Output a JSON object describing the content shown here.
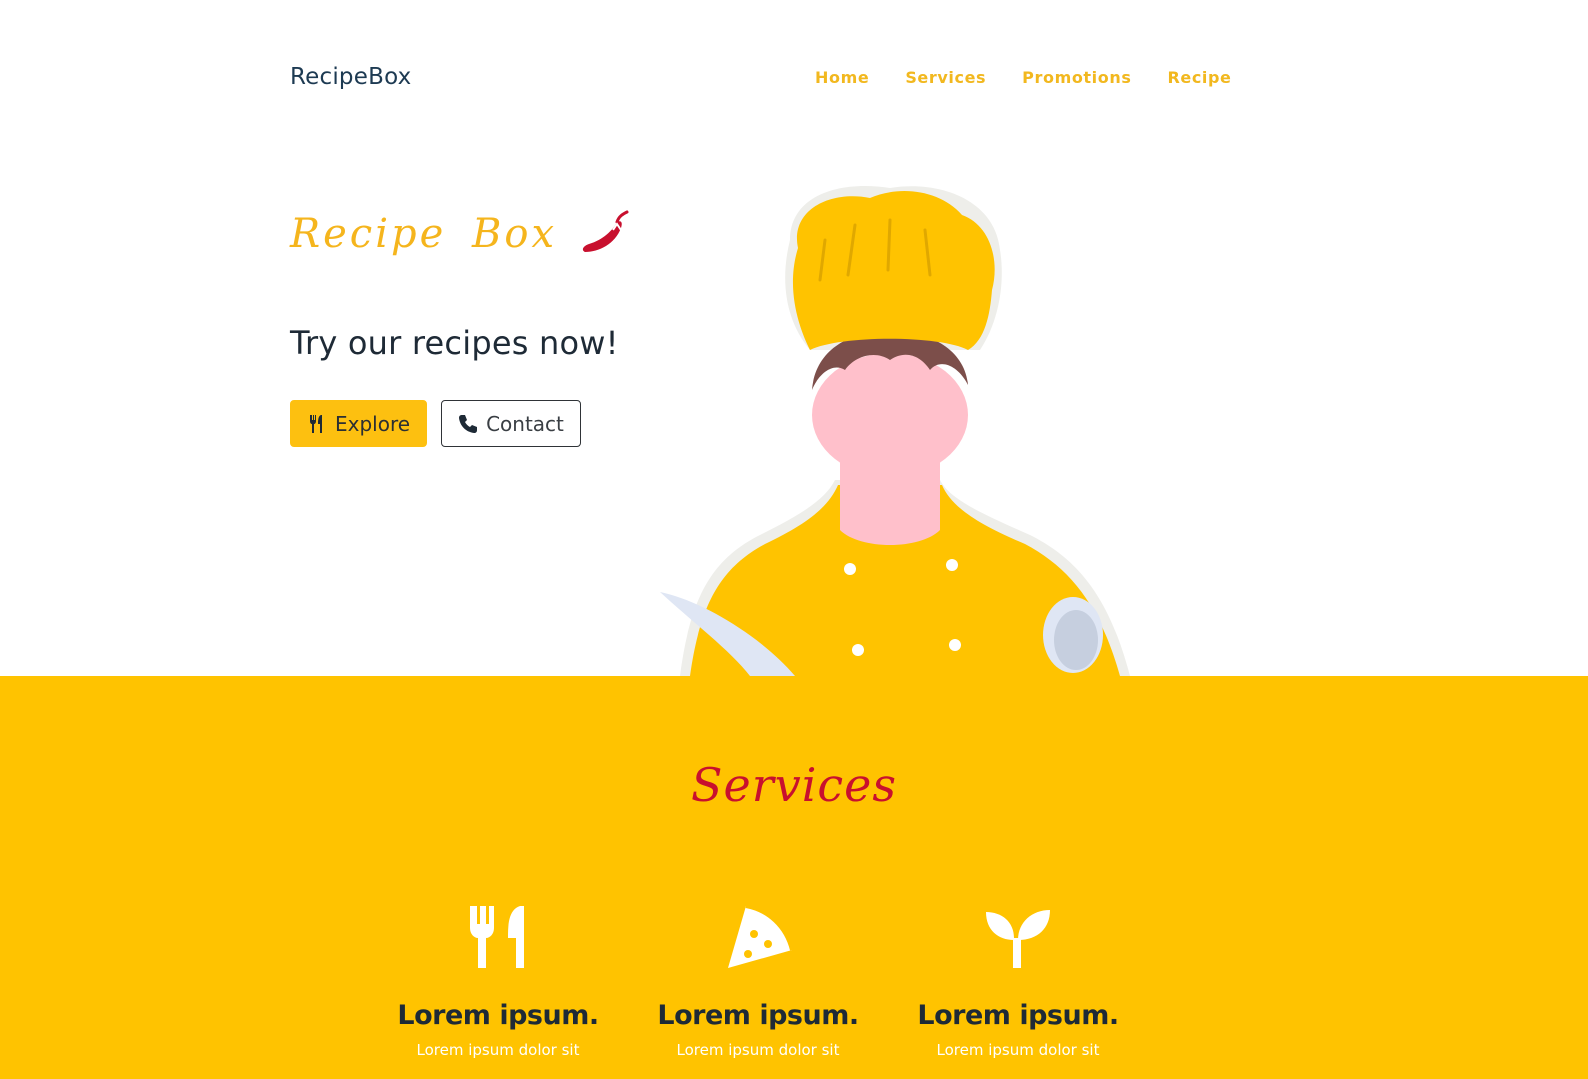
{
  "navbar": {
    "brand": "RecipeBox",
    "links": [
      "Home",
      "Services",
      "Promotions",
      "Recipe"
    ]
  },
  "hero": {
    "title": "Recipe Box",
    "tagline": "Try our recipes now!",
    "explore_label": "Explore",
    "contact_label": "Contact"
  },
  "services": {
    "title": "Services",
    "cards": [
      {
        "icon": "utensils-icon",
        "title": "Lorem ipsum.",
        "text": "Lorem ipsum dolor sit"
      },
      {
        "icon": "pizza-slice-icon",
        "title": "Lorem ipsum.",
        "text": "Lorem ipsum dolor sit"
      },
      {
        "icon": "seedling-icon",
        "title": "Lorem ipsum.",
        "text": "Lorem ipsum dolor sit"
      }
    ]
  },
  "colors": {
    "accent": "#ffc300",
    "nav_link": "#f2b81f",
    "brand_text": "#1d3a52",
    "services_title": "#c8102e"
  }
}
